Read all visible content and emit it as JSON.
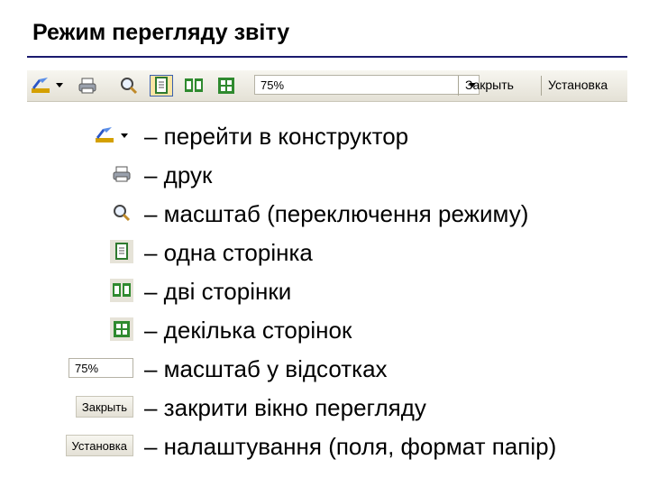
{
  "title": "Режим перегляду звіту",
  "toolbar": {
    "zoom_value": "75%",
    "close_label": "Закрыть",
    "setup_label": "Установка"
  },
  "legend": [
    {
      "icon": "design-view-icon",
      "text": "– перейти в конструктор"
    },
    {
      "icon": "print-icon",
      "text": "– друк"
    },
    {
      "icon": "zoom-icon",
      "text": "– масштаб (переключення режиму)"
    },
    {
      "icon": "one-page-icon",
      "text": "– одна сторінка"
    },
    {
      "icon": "two-pages-icon",
      "text": "– дві сторінки"
    },
    {
      "icon": "multiple-pages-icon",
      "text": "– декілька сторінок"
    },
    {
      "icon": "zoom-percent-combo",
      "label": "75%",
      "text": "– масштаб у відсотках"
    },
    {
      "icon": "close-button",
      "label": "Закрыть",
      "text": "– закрити вікно перегляду"
    },
    {
      "icon": "setup-button",
      "label": "Установка",
      "text": "– налаштування (поля, формат папір)"
    }
  ],
  "colors": {
    "rule": "#1a1a6e",
    "pressed_bg": "#fbe5a5",
    "pressed_border": "#3a5fae"
  }
}
